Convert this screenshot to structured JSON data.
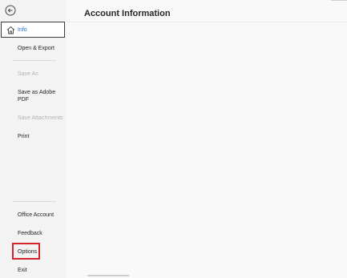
{
  "sidebar": {
    "back_label": "Back",
    "items": [
      {
        "label": "Info",
        "icon": "home-icon"
      },
      {
        "label": "Open & Export"
      },
      {
        "label": "Save As"
      },
      {
        "label": "Save as Adobe PDF"
      },
      {
        "label": "Save Attachments"
      },
      {
        "label": "Print"
      },
      {
        "label": "Office Account"
      },
      {
        "label": "Feedback"
      },
      {
        "label": "Options"
      },
      {
        "label": "Exit"
      }
    ]
  },
  "main": {
    "title": "Account Information"
  },
  "colors": {
    "accent": "#1a6bd1",
    "highlight_box": "#d2262c",
    "sidebar_bg": "#f3f3f3",
    "disabled_text": "#b3b3b3"
  }
}
